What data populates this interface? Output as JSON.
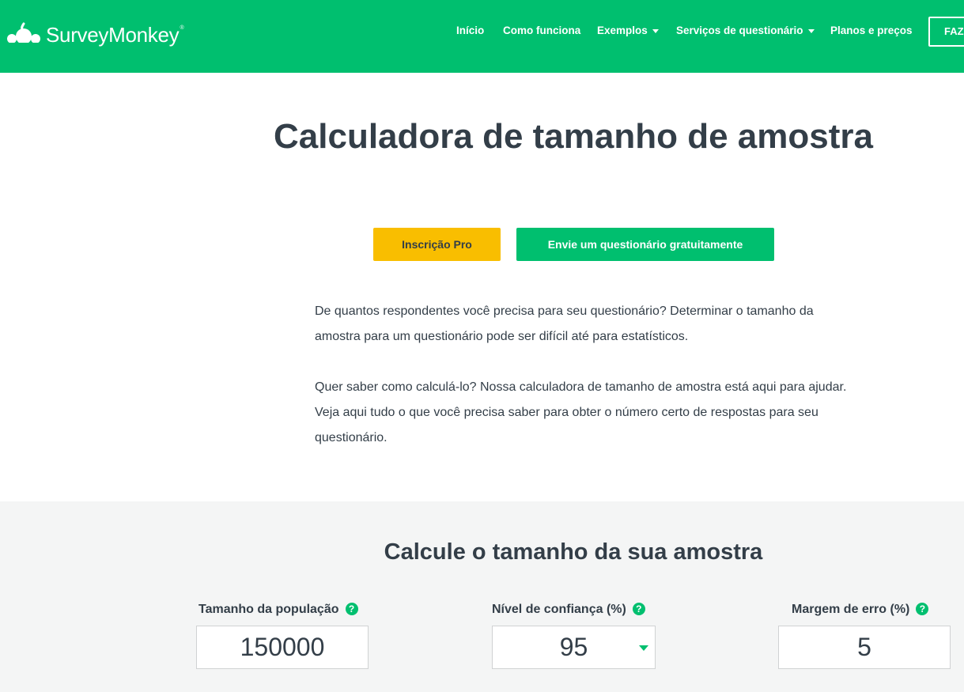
{
  "nav": {
    "brand": "SurveyMonkey",
    "brand_mark": "®",
    "links": [
      {
        "label": "Início"
      },
      {
        "label": "Como funciona"
      },
      {
        "label": "Exemplos"
      },
      {
        "label": "Serviços de questionário"
      },
      {
        "label": "Planos e preços"
      }
    ],
    "cta_label": "FAZER LOGIN"
  },
  "hero": {
    "title": "Calculadora de tamanho de amostra",
    "btn_pro": "Inscrição Pro",
    "btn_free": "Envie um questionário gratuitamente",
    "paragraph1": "De quantos respondentes você precisa para seu questionário? Determinar o tamanho da amostra para um questionário pode ser difícil até para estatísticos.",
    "paragraph2": "Quer saber como calculá-lo? Nossa calculadora de tamanho de amostra está aqui para ajudar. Veja aqui tudo o que você precisa saber para obter o número certo de respostas para seu questionário."
  },
  "calculator": {
    "title": "Calcule o tamanho da sua amostra",
    "help_glyph": "?",
    "population_label": "Tamanho da população",
    "population_value": "150000",
    "confidence_label": "Nível de confiança (%)",
    "confidence_value": "95",
    "margin_label": "Margem de erro (%)",
    "margin_value": "5"
  },
  "colors": {
    "brand_green": "#00bf6f",
    "pro_yellow": "#f9be00",
    "text_dark": "#333e48",
    "section_gray": "#f4f5f5"
  }
}
